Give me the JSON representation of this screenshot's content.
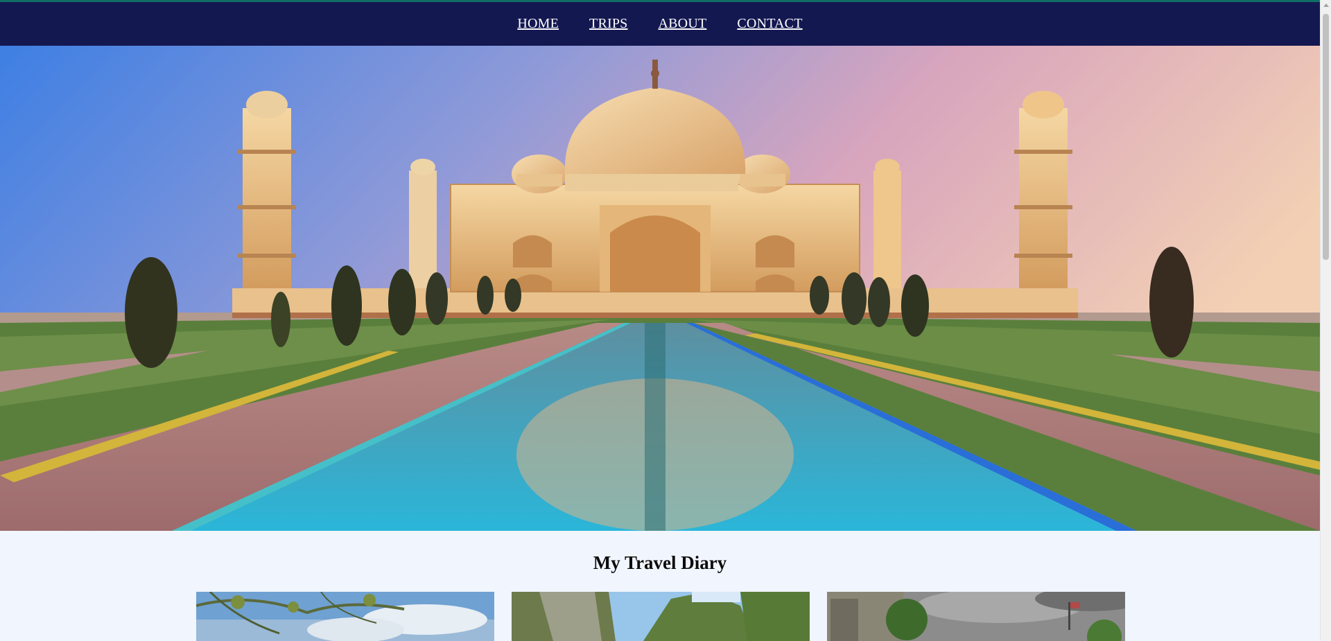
{
  "nav": {
    "items": [
      {
        "label": "HOME"
      },
      {
        "label": "TRIPS"
      },
      {
        "label": "ABOUT"
      },
      {
        "label": "CONTACT"
      }
    ]
  },
  "hero": {
    "image": "taj-mahal-photo"
  },
  "diary": {
    "title": "My Travel Diary",
    "cards": [
      {
        "image": "tree-and-sky-photo"
      },
      {
        "image": "limestone-cliffs-photo"
      },
      {
        "image": "ruins-and-stormy-sky-photo"
      }
    ]
  },
  "colors": {
    "nav_bg": "#141850",
    "top_accent": "#0f6e66",
    "page_bg": "#f1f5fd",
    "nav_text": "#ffffff"
  }
}
